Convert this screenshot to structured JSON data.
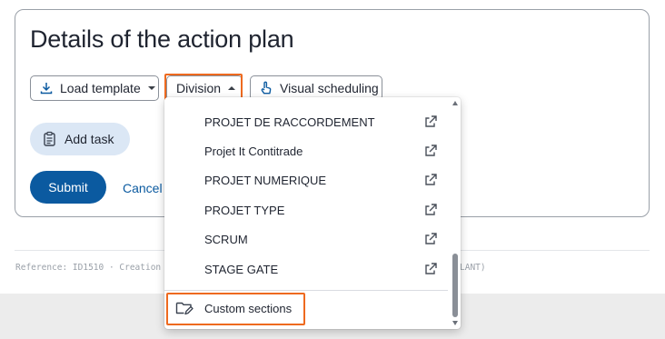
{
  "card": {
    "title": "Details of the action plan",
    "load_template_label": "Load template",
    "division_label": "Division",
    "visual_scheduling_label": "Visual scheduling",
    "add_task_label": "Add task",
    "submit_label": "Submit",
    "cancel_label": "Cancel"
  },
  "meta": {
    "reference_text": "Reference: ID1510 · Creation c",
    "tail_text": "LANT)"
  },
  "dropdown": {
    "items": [
      {
        "label": "PROJET DE RACCORDEMENT",
        "icon": "external-link-icon"
      },
      {
        "label": "Projet It Contitrade",
        "icon": "external-link-icon"
      },
      {
        "label": "PROJET NUMERIQUE",
        "icon": "external-link-icon"
      },
      {
        "label": "PROJET TYPE",
        "icon": "external-link-icon"
      },
      {
        "label": "SCRUM",
        "icon": "external-link-icon"
      },
      {
        "label": "STAGE GATE",
        "icon": "external-link-icon"
      }
    ],
    "custom_sections_label": "Custom sections",
    "custom_sections_icon": "folder-edit-icon"
  },
  "colors": {
    "primary": "#0b5aa0",
    "highlight": "#ee6a1f",
    "add_task_bg": "#dbe7f5"
  }
}
